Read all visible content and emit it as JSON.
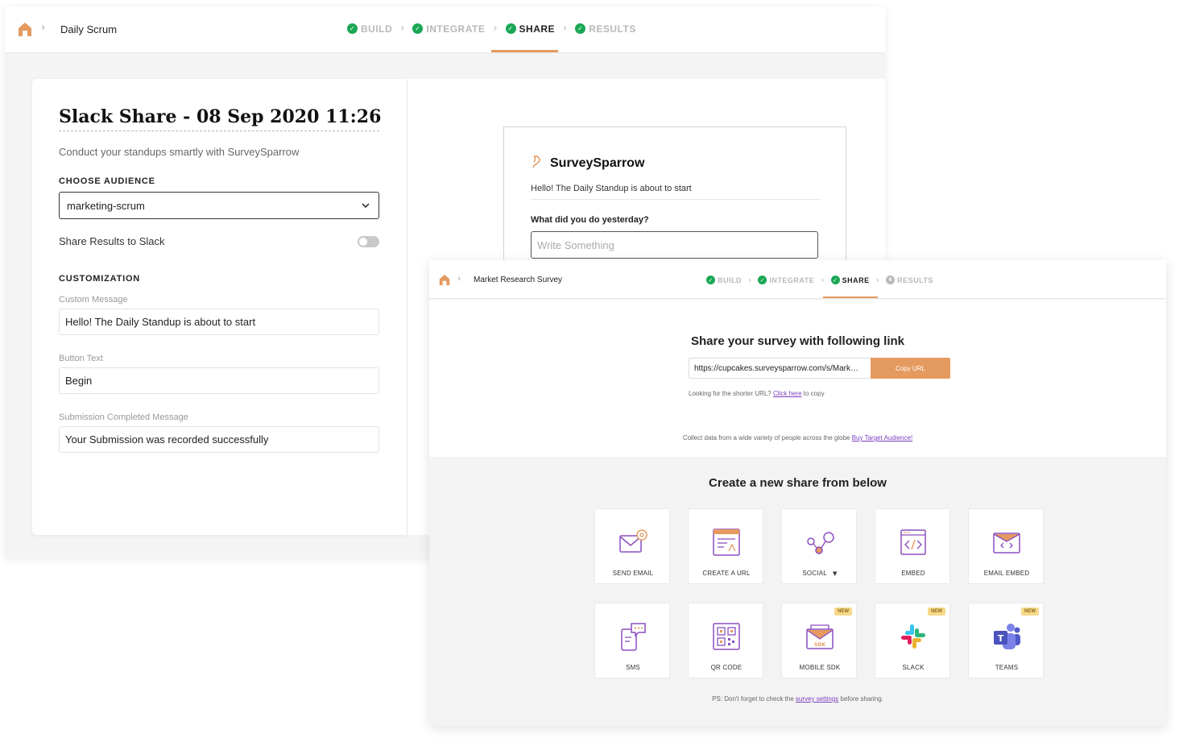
{
  "back_window": {
    "breadcrumb": "Daily Scrum",
    "steps": [
      {
        "label": "BUILD",
        "status": "done"
      },
      {
        "label": "INTEGRATE",
        "status": "done"
      },
      {
        "label": "SHARE",
        "status": "active"
      },
      {
        "label": "RESULTS",
        "status": "done"
      }
    ],
    "form": {
      "title": "Slack Share - 08 Sep 2020 11:26",
      "subtitle": "Conduct your standups smartly with SurveySparrow",
      "audience_label": "CHOOSE AUDIENCE",
      "audience_value": "marketing-scrum",
      "share_results_label": "Share Results to Slack",
      "share_results_enabled": false,
      "customization_label": "CUSTOMIZATION",
      "custom_message_label": "Custom Message",
      "custom_message_value": "Hello! The Daily Standup is about to start",
      "button_text_label": "Button Text",
      "button_text_value": "Begin",
      "submission_label": "Submission Completed Message",
      "submission_value": "Your Submission was recorded successfully"
    },
    "preview": {
      "brand": "SurveySparrow",
      "message": "Hello! The Daily Standup is about to start",
      "question": "What did you do yesterday?",
      "placeholder": "Write Something"
    }
  },
  "front_window": {
    "breadcrumb": "Market Research Survey",
    "steps": [
      {
        "label": "BUILD",
        "status": "done"
      },
      {
        "label": "INTEGRATE",
        "status": "done"
      },
      {
        "label": "SHARE",
        "status": "active"
      },
      {
        "label": "RESULTS",
        "status": "pending",
        "number": "4"
      }
    ],
    "share_heading": "Share your survey with following link",
    "url": "https://cupcakes.surveysparrow.com/s/Mark…",
    "copy_button": "Copy URL",
    "short_url_prefix": "Looking for the shorter URL?",
    "short_url_link": "Click here",
    "short_url_suffix": "to copy",
    "collect_text": "Collect data from a wide variety of people across the globe",
    "collect_link": "Buy Target Audience!",
    "create_heading": "Create a new share from below",
    "tiles": [
      {
        "label": "SEND EMAIL",
        "icon": "send-email-icon",
        "new": false
      },
      {
        "label": "CREATE A URL",
        "icon": "create-url-icon",
        "new": false
      },
      {
        "label": "SOCIAL",
        "icon": "social-icon",
        "new": false,
        "dropdown": true
      },
      {
        "label": "EMBED",
        "icon": "embed-icon",
        "new": false
      },
      {
        "label": "EMAIL EMBED",
        "icon": "email-embed-icon",
        "new": false
      },
      {
        "label": "SMS",
        "icon": "sms-icon",
        "new": false
      },
      {
        "label": "QR CODE",
        "icon": "qr-code-icon",
        "new": false
      },
      {
        "label": "MOBILE SDK",
        "icon": "mobile-sdk-icon",
        "new": true
      },
      {
        "label": "SLACK",
        "icon": "slack-icon",
        "new": true
      },
      {
        "label": "TEAMS",
        "icon": "teams-icon",
        "new": true
      }
    ],
    "new_badge": "NEW",
    "ps_prefix": "PS: Don't forget to check the",
    "ps_link": "survey settings",
    "ps_suffix": "before sharing."
  },
  "colors": {
    "accent": "#e59a5f",
    "check_green": "#1aa755",
    "icon_purple": "#8b4fc0",
    "link_purple": "#7b3fbf"
  }
}
